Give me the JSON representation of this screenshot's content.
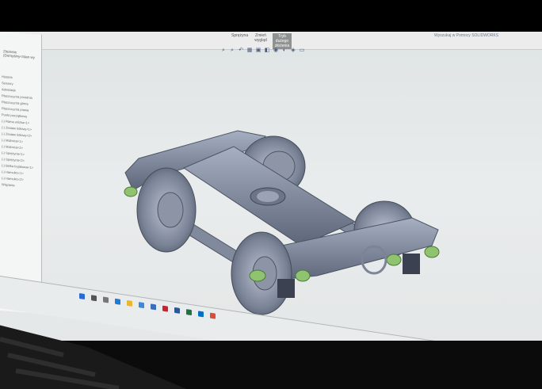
{
  "app": {
    "name": "SOLIDWORKS",
    "ribbon_tools": [
      "Sprężyna",
      "Zmień wygląd",
      "Tryb dużego złożenia"
    ],
    "active_tool": "Tryb dużego złożenia",
    "ribbon_right": "Wyszukaj w Pomocy SOLIDWORKS"
  },
  "tree": {
    "title": "Złożenie (Domyślny<Stan wy",
    "items": [
      "Historia",
      "Sensory",
      "Adnotacje",
      "Płaszczyzna przednia",
      "Płaszczyzna górna",
      "Płaszczyzna prawa",
      "Punkt początkowy",
      "(-) Rama wózka<1>",
      "(-) Zestaw kołowy<1>",
      "(-) Zestaw kołowy<2>",
      "(-) Maźnica<1>",
      "(-) Maźnica<2>",
      "(-) Sprężyna<1>",
      "(-) Sprężyna<2>",
      "(-) Belka bujakowa<1>",
      "(-) Hamulec<1>",
      "(-) Hamulec<2>",
      "Wiązania"
    ]
  },
  "colors": {
    "model_body": "#7e889c",
    "spring_green": "#8fc370",
    "background": "#e3e6e6"
  },
  "icons": [
    "zoom-fit-icon",
    "zoom-area-icon",
    "previous-view-icon",
    "section-view-icon",
    "view-orientation-icon",
    "display-style-icon",
    "hide-show-icon",
    "edit-appearance-icon",
    "scene-icon",
    "view-settings-icon"
  ],
  "taskbar_icons": [
    "start-icon",
    "search-icon",
    "task-view-icon",
    "edge-icon",
    "explorer-icon",
    "store-icon",
    "mail-icon",
    "solidworks-icon",
    "word-icon",
    "excel-icon",
    "outlook-icon",
    "chrome-icon"
  ]
}
